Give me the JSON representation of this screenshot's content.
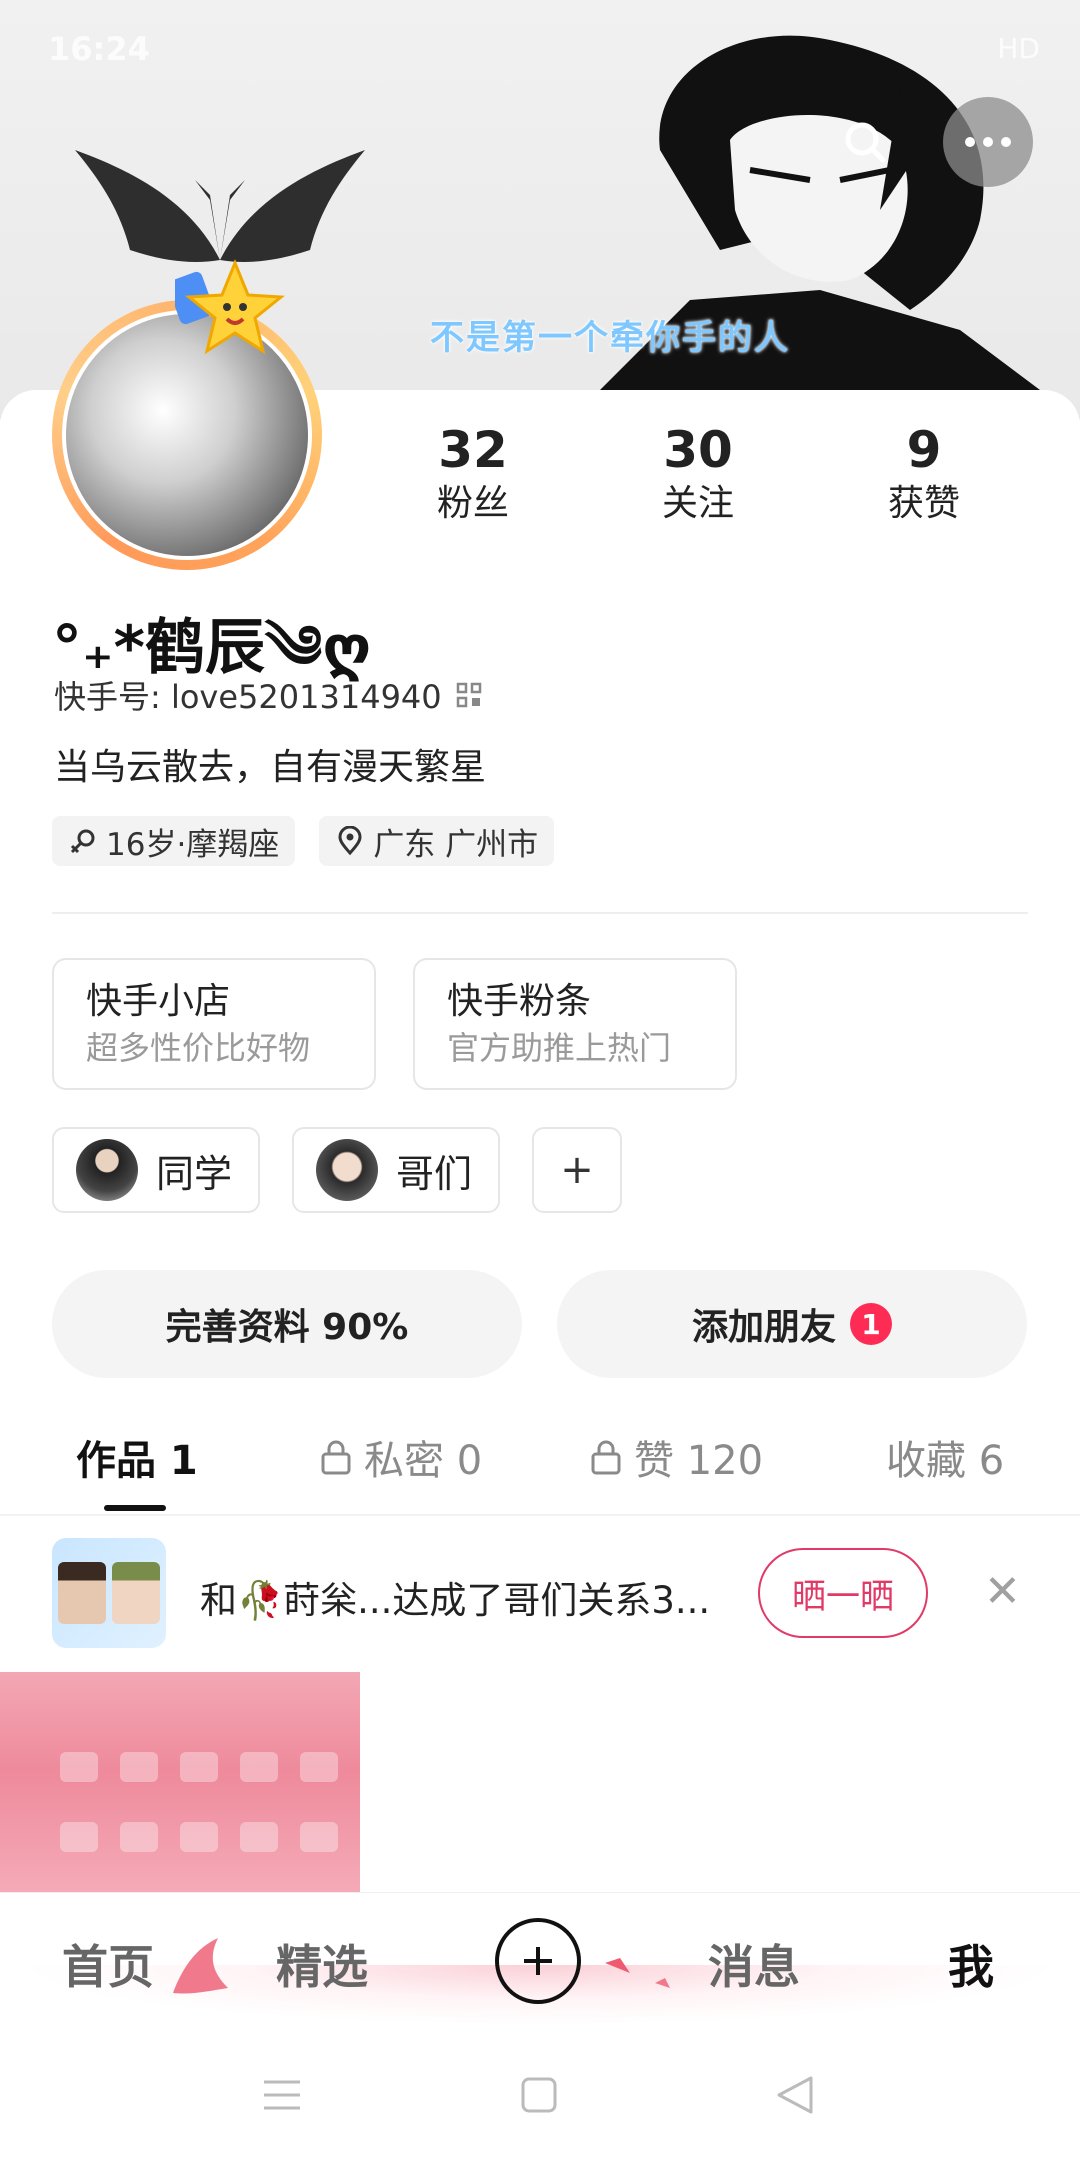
{
  "status_bar": {
    "time": "16:24",
    "network": "HD"
  },
  "banner": {
    "caption": "不是第一个牵你手的人"
  },
  "header_buttons": {
    "search_icon": "search-icon",
    "more_icon": "more-dots-icon"
  },
  "profile": {
    "nickname": "°₊*鹤辰༄ღ",
    "kuaishou_id": "快手号: love5201314940",
    "bio": "当乌云散去，自有漫天繁星",
    "tags": [
      {
        "icon": "gender-icon",
        "text": "16岁·摩羯座"
      },
      {
        "icon": "location-pin-icon",
        "text": "广东 广州市"
      }
    ]
  },
  "stats": [
    {
      "value": "32",
      "label": "粉丝"
    },
    {
      "value": "30",
      "label": "关注"
    },
    {
      "value": "9",
      "label": "获赞"
    }
  ],
  "services": [
    {
      "title": "快手小店",
      "subtitle": "超多性价比好物"
    },
    {
      "title": "快手粉条",
      "subtitle": "官方助推上热门"
    }
  ],
  "friends": [
    {
      "label": "同学"
    },
    {
      "label": "哥们"
    }
  ],
  "actions": {
    "complete_profile": "完善资料 90%",
    "add_friend": "添加朋友",
    "add_friend_badge": "1"
  },
  "tabs": [
    {
      "label": "作品 1",
      "locked": false,
      "active": true
    },
    {
      "label": "私密 0",
      "locked": true,
      "active": false
    },
    {
      "label": "赞 120",
      "locked": true,
      "active": false
    },
    {
      "label": "收藏 6",
      "locked": false,
      "active": false
    }
  ],
  "relationship": {
    "text": "和🥀莳枀...达成了哥们关系3...",
    "button": "晒一晒"
  },
  "bottom_nav": [
    {
      "label": "首页"
    },
    {
      "label": "精选"
    },
    {
      "label": "消息"
    },
    {
      "label": "我"
    }
  ],
  "colors": {
    "accent": "#fe2c55",
    "show_button": "#e03a67",
    "caption": "#7ec8ff"
  }
}
